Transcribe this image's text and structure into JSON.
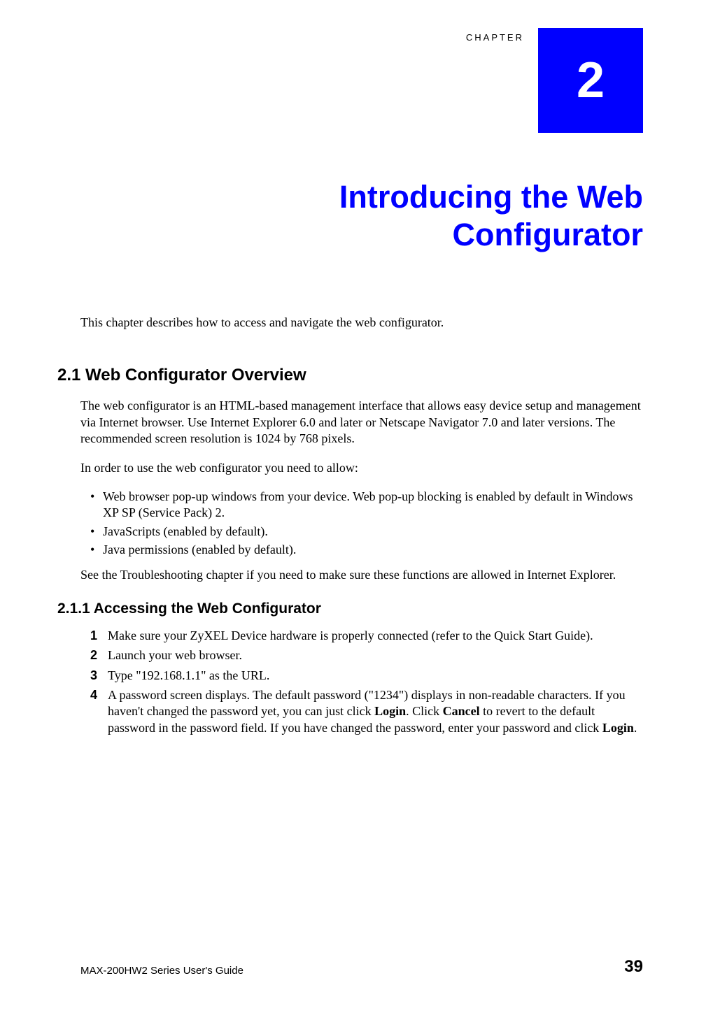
{
  "chapter": {
    "label": "CHAPTER",
    "number": "2",
    "title_line1": "Introducing the Web",
    "title_line2": "Configurator"
  },
  "intro": "This chapter describes how to access and navigate the web configurator.",
  "section_2_1": {
    "heading": "2.1  Web Configurator Overview",
    "para1": "The web configurator is an HTML-based management interface that allows easy device setup and management via Internet browser. Use Internet Explorer 6.0 and later or Netscape Navigator 7.0 and later versions. The recommended screen resolution is 1024 by 768 pixels.",
    "para2": "In order to use the web configurator you need to allow:",
    "bullets": [
      "Web browser pop-up windows from your device. Web pop-up blocking is enabled by default in Windows XP SP (Service Pack) 2.",
      "JavaScripts (enabled by default).",
      "Java permissions (enabled by default)."
    ],
    "para3": "See the Troubleshooting chapter if you need to make sure these functions are allowed in Internet Explorer."
  },
  "section_2_1_1": {
    "heading": "2.1.1  Accessing the Web Configurator",
    "steps": [
      {
        "num": "1",
        "text_pre": "Make sure your ZyXEL Device hardware is properly connected (refer to the Quick Start Guide)."
      },
      {
        "num": "2",
        "text_pre": "Launch your web browser."
      },
      {
        "num": "3",
        "text_pre": "Type \"192.168.1.1\" as the URL."
      },
      {
        "num": "4",
        "text_pre": "A password screen displays. The default password (\"1234\") displays in non-readable characters. If you haven't changed the password yet, you can just click ",
        "bold1": "Login",
        "text_mid": ". Click ",
        "bold2": "Cancel",
        "text_mid2": " to revert to the default password in the password field. If you have changed the password, enter your password and click ",
        "bold3": "Login",
        "text_post": "."
      }
    ]
  },
  "footer": {
    "guide": "MAX-200HW2 Series User's Guide",
    "page": "39"
  }
}
